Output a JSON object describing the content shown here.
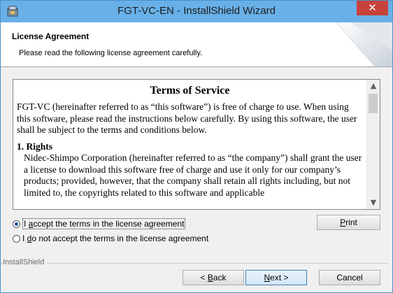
{
  "window": {
    "title": "FGT-VC-EN - InstallShield Wizard",
    "close_glyph": "✕",
    "icon": "installer-icon"
  },
  "header": {
    "title": "License Agreement",
    "subtitle": "Please read the following license agreement carefully."
  },
  "license": {
    "heading": "Terms of Service",
    "intro": "FGT-VC (hereinafter referred to as “this software”) is free of charge to use.  When using this software, please read the instructions below carefully.  By using this software, the user shall be subject to the terms and conditions below.",
    "section1_title": "1. Rights",
    "section1_body": "Nidec-Shimpo Corporation (hereinafter referred to as “the company”) shall grant the user a license to download this software free of charge and use it only for our company’s products; provided, however, that the company shall retain all rights including, but not limited to, the copyrights related to this software and applicable"
  },
  "options": {
    "accept": {
      "pre": "I ",
      "u": "a",
      "post": "ccept the terms in the license agreement",
      "checked": true
    },
    "decline": {
      "pre": "I ",
      "u": "d",
      "post": "o not accept the terms in the license agreement",
      "checked": false
    }
  },
  "buttons": {
    "print": {
      "u": "P",
      "rest": "rint"
    },
    "back": {
      "pre": "< ",
      "u": "B",
      "rest": "ack"
    },
    "next": {
      "u": "N",
      "rest": "ext >"
    },
    "cancel": "Cancel"
  },
  "footer": {
    "brand": "InstallShield"
  },
  "colors": {
    "titlebar": "#69b0e8",
    "close": "#c7423a",
    "window_bg": "#f0f0f0"
  }
}
